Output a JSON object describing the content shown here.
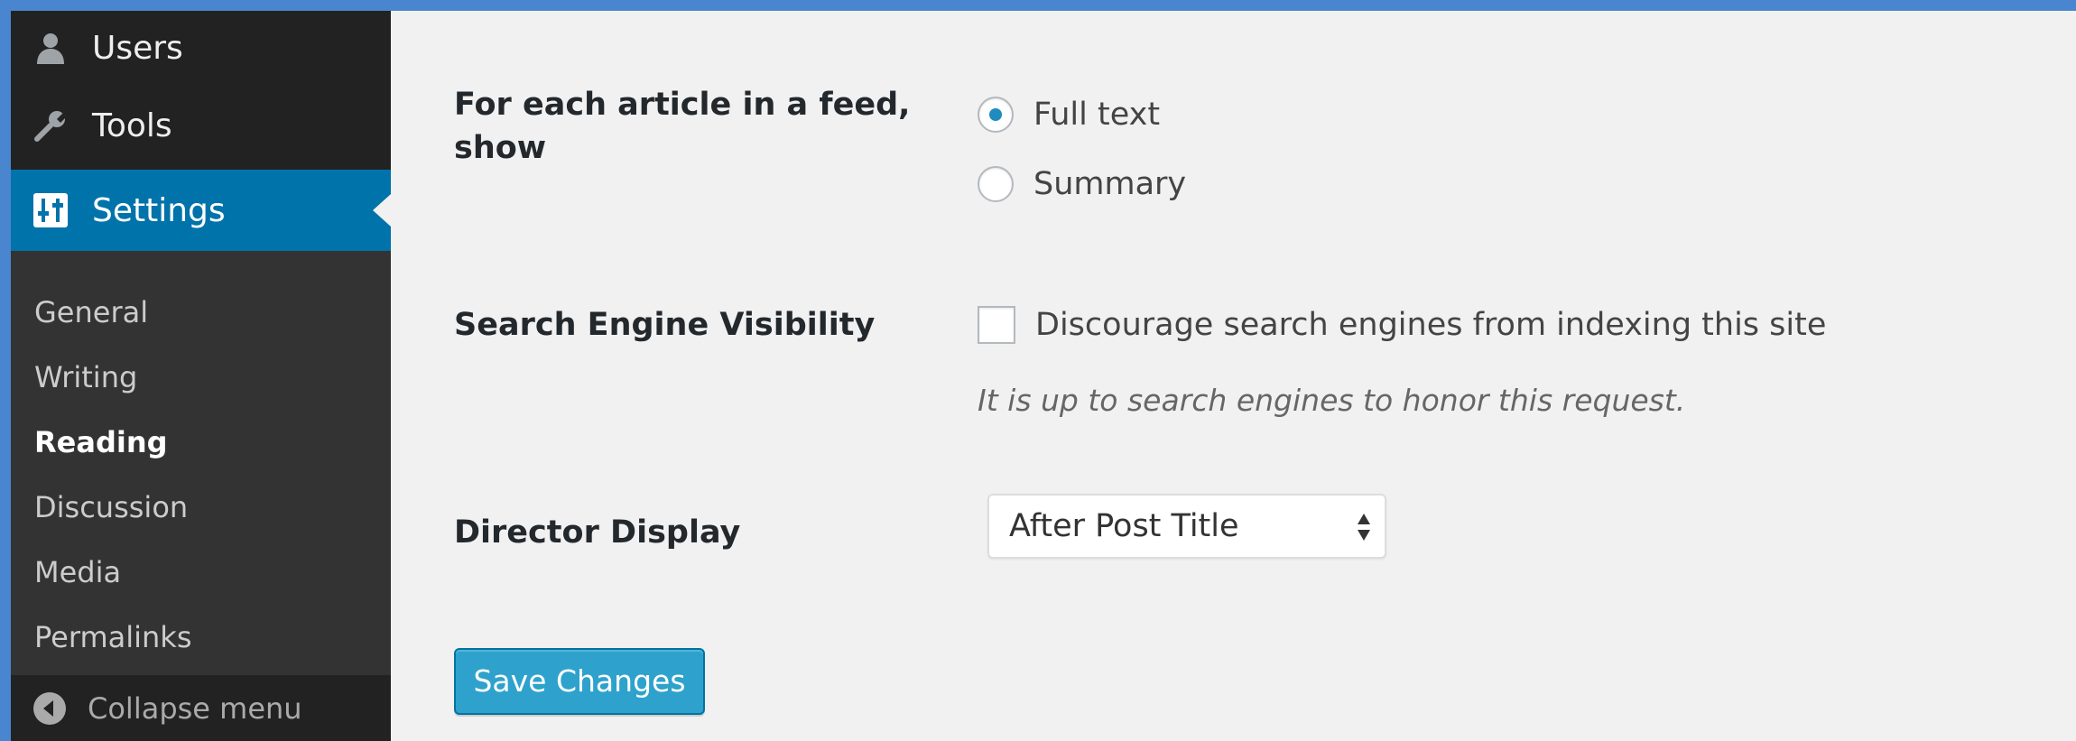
{
  "sidebar": {
    "menu": {
      "users": {
        "label": "Users",
        "icon": "user-icon"
      },
      "tools": {
        "label": "Tools",
        "icon": "wrench-icon"
      },
      "settings": {
        "label": "Settings",
        "icon": "settings-sliders-icon"
      }
    },
    "submenu": [
      {
        "label": "General"
      },
      {
        "label": "Writing"
      },
      {
        "label": "Reading"
      },
      {
        "label": "Discussion"
      },
      {
        "label": "Media"
      },
      {
        "label": "Permalinks"
      }
    ],
    "current_submenu": "Reading",
    "collapse_label": "Collapse menu"
  },
  "form": {
    "feed_article": {
      "label": "For each article in a feed, show",
      "options": [
        {
          "label": "Full text",
          "checked": true
        },
        {
          "label": "Summary",
          "checked": false
        }
      ]
    },
    "search_visibility": {
      "label": "Search Engine Visibility",
      "checkbox_label": "Discourage search engines from indexing this site",
      "checked": false,
      "description": "It is up to search engines to honor this request."
    },
    "director_display": {
      "label": "Director Display",
      "selected": "After Post Title"
    },
    "save_label": "Save Changes"
  },
  "colors": {
    "frame": "#4a86cf",
    "sidebar": "#222222",
    "submenu": "#333333",
    "active": "#0073aa",
    "button": "#2ea2cc",
    "radio_dot": "#1e8cbe",
    "background": "#f1f1f1"
  }
}
